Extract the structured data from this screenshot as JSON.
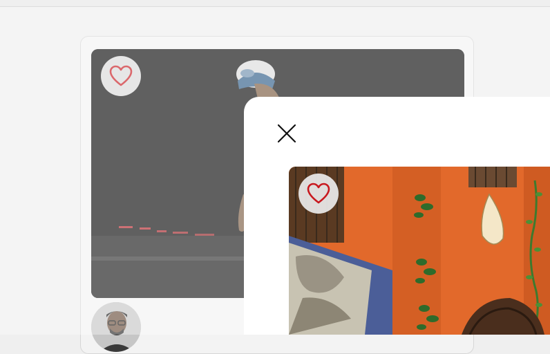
{
  "header": {},
  "feed": {
    "card": {
      "like_icon": "heart-outline-icon",
      "photo_subject": "person-in-cap-dark-street",
      "author_avatar": "avatar-man-with-glasses"
    }
  },
  "modal": {
    "close_icon": "close-icon",
    "like_icon": "heart-outline-icon",
    "photo_subject": "orange-building-wall-painted-motifs"
  },
  "colors": {
    "page_bg": "#efefef",
    "heart_red": "#c8181e",
    "modal_bg": "#ffffff",
    "orange_wall": "#e06a2c"
  }
}
